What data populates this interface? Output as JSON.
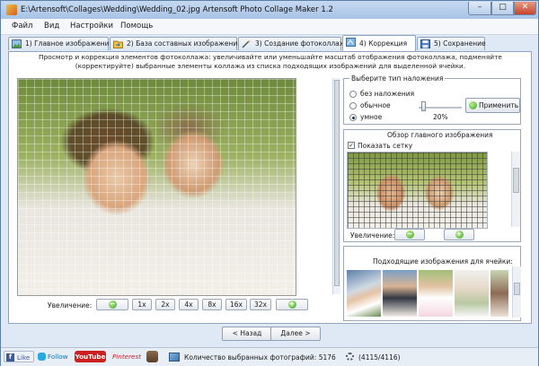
{
  "window": {
    "title": "E:\\Artensoft\\Collages\\Wedding\\Wedding_02.jpg Artensoft Photo Collage Maker 1.2",
    "minimize": "–",
    "maximize": "□",
    "close": "✕"
  },
  "menu": [
    "Файл",
    "Вид",
    "Настройки",
    "Помощь"
  ],
  "tabs": [
    {
      "label": "1) Главное изображение",
      "icon": "image-icon"
    },
    {
      "label": "2) База составных изображений",
      "icon": "folder-arrow-icon"
    },
    {
      "label": "3) Создание фотоколлажа",
      "icon": "wand-icon"
    },
    {
      "label": "4) Коррекция",
      "icon": "correction-icon",
      "active": true
    },
    {
      "label": "5) Сохранение",
      "icon": "save-icon"
    }
  ],
  "hint": "Просмотр и коррекция элементов фотоколлажа: увеличивайте или уменьшайте масштаб отображения фотоколлажа, подменяйте (корректируйте) выбранные элементы коллажа из списка подходящих изображений для выделенной ячейки.",
  "zoom": {
    "label": "Увеличение:",
    "buttons": [
      "1x",
      "2x",
      "4x",
      "8x",
      "16x",
      "32x"
    ]
  },
  "overlay": {
    "title": "Выберите тип наложения",
    "options": [
      "без наложения",
      "обычное",
      "умное"
    ],
    "selected": "умное",
    "percent": "20%",
    "percent_value": 20,
    "apply": "Применить"
  },
  "overview": {
    "title": "Обзор главного изображения",
    "show_grid": "Показать сетку",
    "show_grid_checked": true,
    "zoom_label": "Увеличение:"
  },
  "matching": {
    "title": "Подходящие изображения для ячейки:"
  },
  "nav": {
    "back": "< Назад",
    "next": "Далее >"
  },
  "status": {
    "like": "Like",
    "follow": "Follow",
    "youtube": "YouTube",
    "pinterest": "Pinterest",
    "count_text": "Количество выбранных фотографий: 5176",
    "progress_text": "(4115/4116)"
  },
  "colors": {
    "accent": "#3ea52a",
    "youtube": "#cc2020",
    "facebook": "#3b5998",
    "twitter": "#29a9e1"
  }
}
